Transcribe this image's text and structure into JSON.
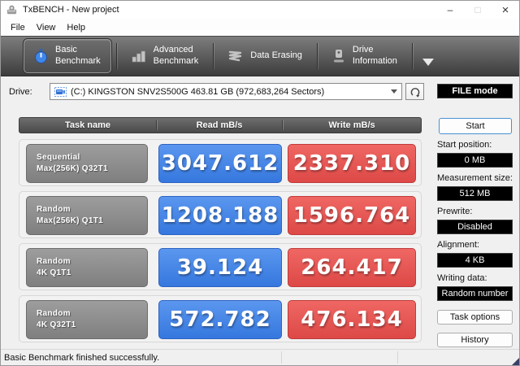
{
  "titlebar": {
    "title": "TxBENCH - New project",
    "minimize_glyph": "–",
    "maximize_glyph": "□",
    "close_glyph": "×"
  },
  "menubar": {
    "items": [
      "File",
      "View",
      "Help"
    ]
  },
  "toolbar": {
    "tabs": [
      {
        "line1": "Basic",
        "line2": "Benchmark",
        "icon": "stopwatch-icon",
        "selected": true
      },
      {
        "line1": "Advanced",
        "line2": "Benchmark",
        "icon": "bar-chart-icon",
        "selected": false
      },
      {
        "line1": "Data Erasing",
        "line2": "",
        "icon": "erase-scribble-icon",
        "selected": false
      },
      {
        "line1": "Drive",
        "line2": "Information",
        "icon": "drive-icon",
        "selected": false
      }
    ]
  },
  "drive_row": {
    "label": "Drive:",
    "selected_drive": "(C:) KINGSTON SNV2S500G  463.81 GB (972,683,264 Sectors)",
    "file_mode": "FILE mode"
  },
  "table": {
    "headers": {
      "task": "Task name",
      "read": "Read mB/s",
      "write": "Write mB/s"
    },
    "rows": [
      {
        "task1": "Sequential",
        "task2": "Max(256K) Q32T1",
        "read": "3047.612",
        "write": "2337.310"
      },
      {
        "task1": "Random",
        "task2": "Max(256K) Q1T1",
        "read": "1208.188",
        "write": "1596.764"
      },
      {
        "task1": "Random",
        "task2": "4K Q1T1",
        "read": "39.124",
        "write": "264.417"
      },
      {
        "task1": "Random",
        "task2": "4K Q32T1",
        "read": "572.782",
        "write": "476.134"
      }
    ]
  },
  "sidebar": {
    "start": "Start",
    "fields": [
      {
        "label": "Start position:",
        "value": "0 MB"
      },
      {
        "label": "Measurement size:",
        "value": "512 MB"
      },
      {
        "label": "Prewrite:",
        "value": "Disabled"
      },
      {
        "label": "Alignment:",
        "value": "4 KB"
      },
      {
        "label": "Writing data:",
        "value": "Random number"
      }
    ],
    "task_options": "Task options",
    "history": "History"
  },
  "statusbar": {
    "message": "Basic Benchmark finished successfully."
  },
  "colors": {
    "read_blue": "#4285e8",
    "write_red": "#e25250",
    "task_gray": "#8d8d8d",
    "header_gray": "#5a5a5a",
    "toolbar_dark": "#4a4a4a",
    "value_box_black": "#000000",
    "start_border_blue": "#4a90d2"
  }
}
